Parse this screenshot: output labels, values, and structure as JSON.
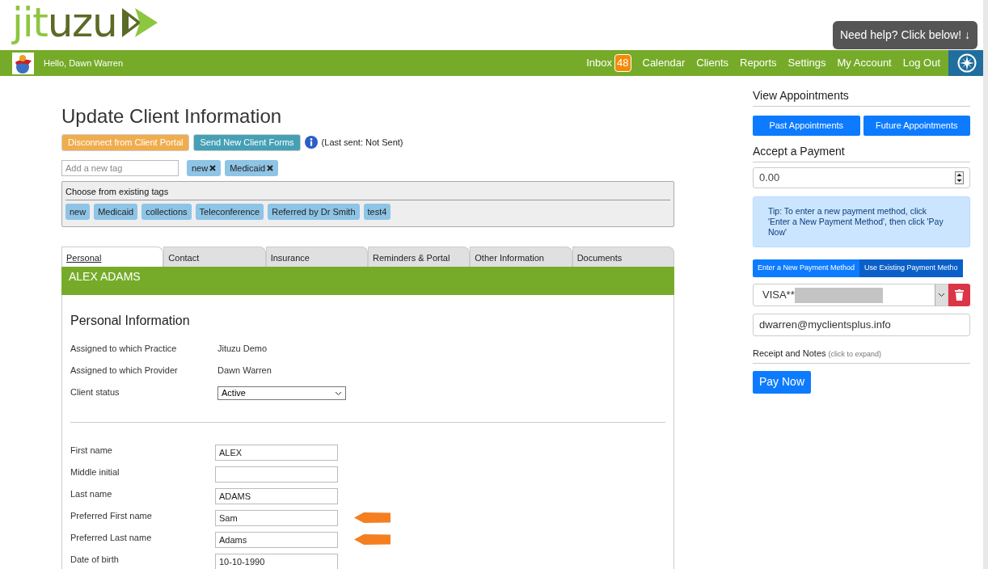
{
  "logo": {
    "parts": [
      "jit",
      "uzu"
    ]
  },
  "help_tooltip": "Need help? Click below! ↓",
  "nav": {
    "greeting": "Hello, Dawn Warren",
    "items": [
      {
        "label": "Inbox",
        "badge": "48"
      },
      {
        "label": "Calendar"
      },
      {
        "label": "Clients"
      },
      {
        "label": "Reports"
      },
      {
        "label": "Settings"
      },
      {
        "label": "My Account"
      },
      {
        "label": "Log Out"
      }
    ]
  },
  "page_title": "Update Client Information",
  "actions": [
    {
      "label": "Disconnect from Client Portal",
      "kind": "warning"
    },
    {
      "label": "Send New Client Forms",
      "kind": "info"
    }
  ],
  "last_sent": "(Last sent: Not Sent)",
  "tag_input": {
    "placeholder": "Add a new tag"
  },
  "applied_tags": [
    "new",
    "Medicaid"
  ],
  "existing_tags": {
    "title": "Choose from existing tags",
    "tags": [
      "new",
      "Medicaid",
      "collections",
      "Teleconference",
      "Referred by Dr Smith",
      "test4"
    ]
  },
  "tabs": [
    {
      "label": "Personal",
      "selected": true
    },
    {
      "label": "Contact",
      "selected": false
    },
    {
      "label": "Insurance",
      "selected": false
    },
    {
      "label": "Reminders & Portal",
      "selected": false
    },
    {
      "label": "Other Information",
      "selected": false
    },
    {
      "label": "Documents",
      "selected": false
    }
  ],
  "client_name": "ALEX ADAMS",
  "section_title": "Personal Information",
  "info_rows": [
    {
      "label": "Assigned to which Practice",
      "kind": "text",
      "value": "Jituzu Demo"
    },
    {
      "label": "Assigned to which Provider",
      "kind": "text",
      "value": "Dawn Warren"
    },
    {
      "label": "Client status",
      "kind": "select",
      "value": "Active"
    }
  ],
  "fields": [
    {
      "label": "First name",
      "value": "ALEX",
      "arrow": false
    },
    {
      "label": "Middle initial",
      "arrow": false
    },
    {
      "label": "Last name",
      "value": "ADAMS",
      "arrow": false
    },
    {
      "label": "Preferred First name",
      "value": "Sam",
      "arrow": true
    },
    {
      "label": "Preferred Last name",
      "value": "Adams",
      "arrow": true
    },
    {
      "label": "Date of birth",
      "value": "10-10-1990",
      "arrow": false
    }
  ],
  "sidebar": {
    "appointments_title": "View Appointments",
    "appointment_buttons": [
      "Past Appointments",
      "Future Appointments"
    ],
    "payment_title": "Accept a Payment",
    "amount": "0.00",
    "tip": "Tip: To enter a new payment method, click 'Enter a New Payment Method', then click 'Pay Now'",
    "method_toggle": [
      {
        "label": "Enter a New Payment Method",
        "selected": false
      },
      {
        "label": "Use Existing Payment Metho",
        "selected": true
      }
    ],
    "card": "VISA**",
    "email": "dwarren@myclientsplus.info",
    "receipt_label": "Receipt and Notes",
    "receipt_hint": "(click to expand)",
    "pay_button": "Pay Now"
  }
}
